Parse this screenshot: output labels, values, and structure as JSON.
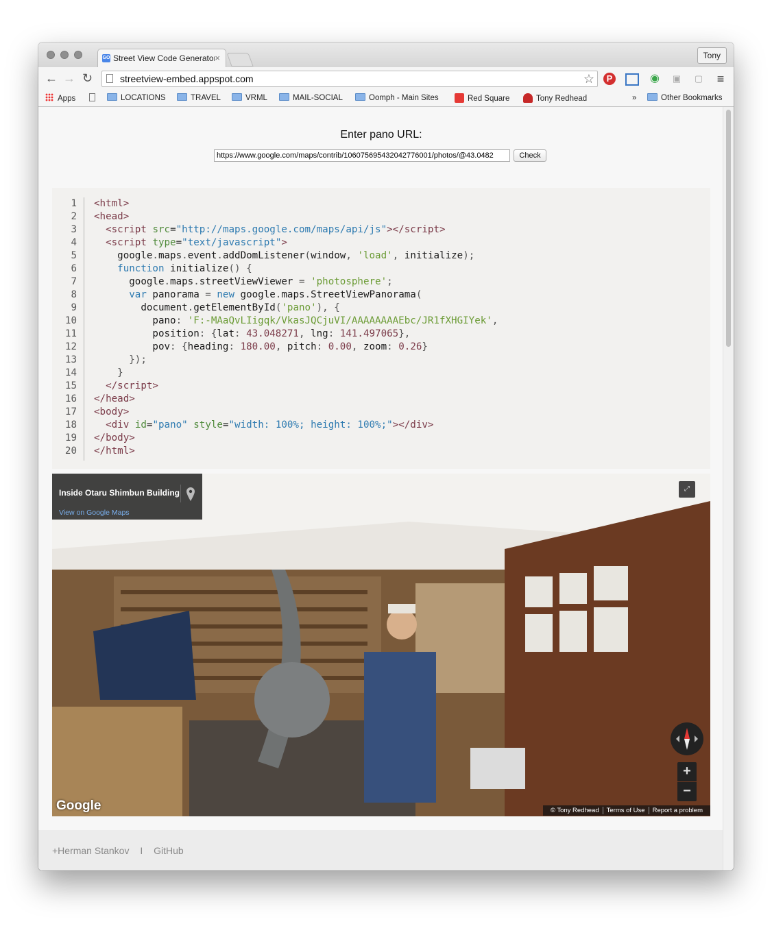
{
  "browser": {
    "tab_title": "Street View Code Generator",
    "tab_close": "×",
    "profile_name": "Tony",
    "favicon_text": "GO",
    "url": "streetview-embed.appspot.com"
  },
  "bookmarks": {
    "items": [
      "Apps",
      "LOCATIONS",
      "TRAVEL",
      "VRML",
      "MAIL-SOCIAL",
      "Oomph - Main Sites",
      "Red Square",
      "Tony Redhead"
    ],
    "overflow": "»",
    "other": "Other Bookmarks"
  },
  "page": {
    "heading": "Enter pano URL:",
    "input_value": "https://www.google.com/maps/contrib/106075695432042776001/photos/@43.0482",
    "check_label": "Check"
  },
  "code": {
    "line_numbers": [
      "1",
      "2",
      "3",
      "4",
      "5",
      "6",
      "7",
      "8",
      "9",
      "10",
      "11",
      "12",
      "13",
      "14",
      "15",
      "16",
      "17",
      "18",
      "19",
      "20"
    ]
  },
  "streetview": {
    "place_name": "Inside Otaru Shimbun Building",
    "view_link": "View on Google Maps",
    "google_logo": "Google",
    "copyright": "© Tony Redhead",
    "terms": "Terms of Use",
    "report": "Report a problem",
    "zoom_in": "+",
    "zoom_out": "−"
  },
  "footer": {
    "author_link": "+Herman Stankov",
    "separator": "I",
    "github_link": "GitHub"
  },
  "colors": {
    "code_bg": "#f2f1ef",
    "tag": "#7a3a48",
    "string": "#2d7ab0",
    "js_string": "#6b9b35"
  }
}
